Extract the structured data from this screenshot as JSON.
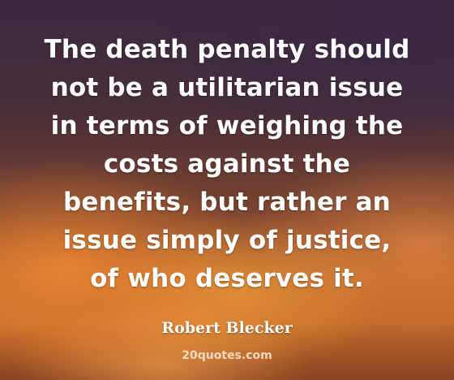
{
  "quote": {
    "lines": [
      "The death penalty should",
      "not be a utilitarian issue",
      "in terms of weighing the",
      "costs against the",
      "benefits, but rather an",
      "issue simply of justice,",
      "of who deserves it."
    ]
  },
  "author": "Robert Blecker",
  "watermark": "20quotes.com",
  "colors": {
    "text": "#ffffff",
    "sky_dark": "#3b2a3e",
    "sky_orange": "#c06a2a"
  }
}
